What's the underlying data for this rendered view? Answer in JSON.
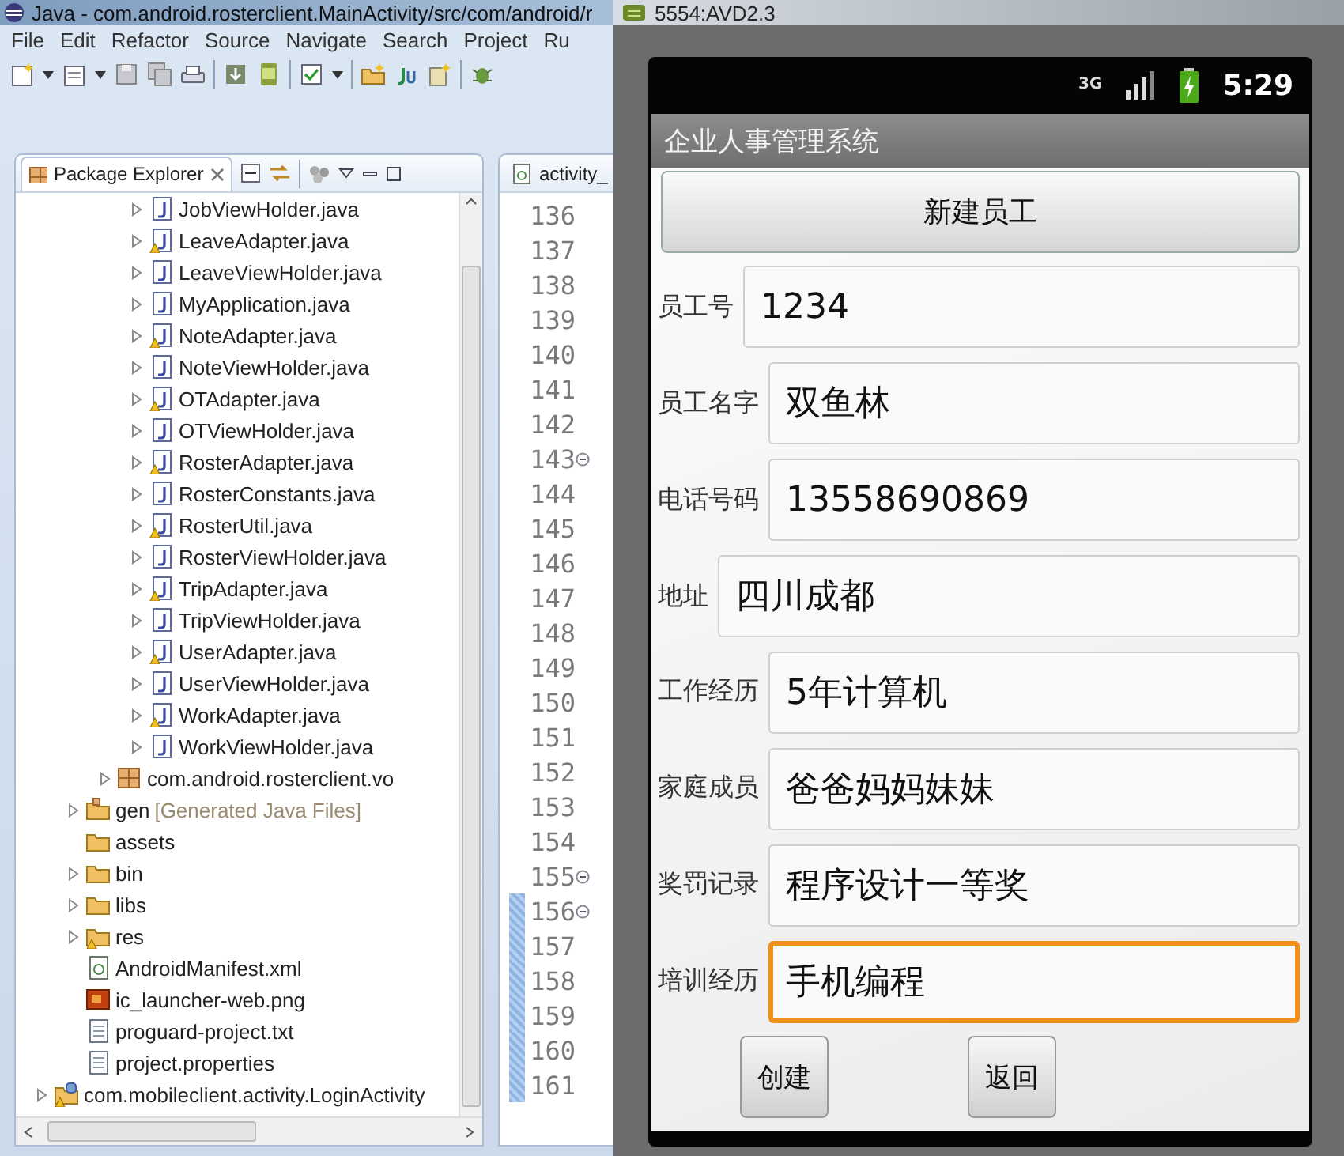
{
  "eclipse": {
    "title": "Java - com.android.rosterclient.MainActivity/src/com/android/r",
    "menu": [
      "File",
      "Edit",
      "Refactor",
      "Source",
      "Navigate",
      "Search",
      "Project",
      "Ru"
    ],
    "view_tab": {
      "label": "Package Explorer",
      "selected": true
    },
    "editor_tab": {
      "label": "activity_",
      "selected": false
    },
    "tree": [
      {
        "children": [
          {
            "children": [
              {
                "children": [
                  {
                    "label": "JobViewHolder.java",
                    "kind": "java-file",
                    "expandable": true,
                    "warning": false
                  },
                  {
                    "label": "LeaveAdapter.java",
                    "kind": "java-file",
                    "expandable": true,
                    "warning": true
                  },
                  {
                    "label": "LeaveViewHolder.java",
                    "kind": "java-file",
                    "expandable": true,
                    "warning": false
                  },
                  {
                    "label": "MyApplication.java",
                    "kind": "java-file",
                    "expandable": true,
                    "warning": false
                  },
                  {
                    "label": "NoteAdapter.java",
                    "kind": "java-file",
                    "expandable": true,
                    "warning": true
                  },
                  {
                    "label": "NoteViewHolder.java",
                    "kind": "java-file",
                    "expandable": true,
                    "warning": false
                  },
                  {
                    "label": "OTAdapter.java",
                    "kind": "java-file",
                    "expandable": true,
                    "warning": true
                  },
                  {
                    "label": "OTViewHolder.java",
                    "kind": "java-file",
                    "expandable": true,
                    "warning": false
                  },
                  {
                    "label": "RosterAdapter.java",
                    "kind": "java-file",
                    "expandable": true,
                    "warning": true
                  },
                  {
                    "label": "RosterConstants.java",
                    "kind": "java-file",
                    "expandable": true,
                    "warning": false
                  },
                  {
                    "label": "RosterUtil.java",
                    "kind": "java-file",
                    "expandable": true,
                    "warning": true
                  },
                  {
                    "label": "RosterViewHolder.java",
                    "kind": "java-file",
                    "expandable": true,
                    "warning": false
                  },
                  {
                    "label": "TripAdapter.java",
                    "kind": "java-file",
                    "expandable": true,
                    "warning": true
                  },
                  {
                    "label": "TripViewHolder.java",
                    "kind": "java-file",
                    "expandable": true,
                    "warning": false
                  },
                  {
                    "label": "UserAdapter.java",
                    "kind": "java-file",
                    "expandable": true,
                    "warning": true
                  },
                  {
                    "label": "UserViewHolder.java",
                    "kind": "java-file",
                    "expandable": true,
                    "warning": false
                  },
                  {
                    "label": "WorkAdapter.java",
                    "kind": "java-file",
                    "expandable": true,
                    "warning": true
                  },
                  {
                    "label": "WorkViewHolder.java",
                    "kind": "java-file",
                    "expandable": true,
                    "warning": false
                  }
                ]
              },
              {
                "label": "com.android.rosterclient.vo",
                "kind": "package",
                "expandable": true,
                "warning": false
              }
            ]
          },
          {
            "label": "gen",
            "note": "[Generated Java Files]",
            "kind": "source-folder",
            "expandable": true,
            "warning": false
          },
          {
            "label": "assets",
            "kind": "folder",
            "expandable": false,
            "warning": false
          },
          {
            "label": "bin",
            "kind": "folder",
            "expandable": true,
            "warning": false
          },
          {
            "label": "libs",
            "kind": "folder",
            "expandable": true,
            "warning": false
          },
          {
            "label": "res",
            "kind": "folder",
            "expandable": true,
            "warning": true
          },
          {
            "label": "AndroidManifest.xml",
            "kind": "xml-file",
            "expandable": false,
            "warning": false
          },
          {
            "label": "ic_launcher-web.png",
            "kind": "image-file",
            "expandable": false,
            "warning": false
          },
          {
            "label": "proguard-project.txt",
            "kind": "text-file",
            "expandable": false,
            "warning": false
          },
          {
            "label": "project.properties",
            "kind": "text-file",
            "expandable": false,
            "warning": false
          }
        ]
      },
      {
        "label": "com.mobileclient.activity.LoginActivity",
        "kind": "project",
        "expandable": true,
        "warning": true
      }
    ],
    "line_numbers": [
      {
        "number": "136",
        "fold": false,
        "marked": false
      },
      {
        "number": "137",
        "fold": false,
        "marked": false
      },
      {
        "number": "138",
        "fold": false,
        "marked": false
      },
      {
        "number": "139",
        "fold": false,
        "marked": false
      },
      {
        "number": "140",
        "fold": false,
        "marked": false
      },
      {
        "number": "141",
        "fold": false,
        "marked": false
      },
      {
        "number": "142",
        "fold": false,
        "marked": false
      },
      {
        "number": "143",
        "fold": true,
        "marked": false
      },
      {
        "number": "144",
        "fold": false,
        "marked": false
      },
      {
        "number": "145",
        "fold": false,
        "marked": false
      },
      {
        "number": "146",
        "fold": false,
        "marked": false
      },
      {
        "number": "147",
        "fold": false,
        "marked": false
      },
      {
        "number": "148",
        "fold": false,
        "marked": false
      },
      {
        "number": "149",
        "fold": false,
        "marked": false
      },
      {
        "number": "150",
        "fold": false,
        "marked": false
      },
      {
        "number": "151",
        "fold": false,
        "marked": false
      },
      {
        "number": "152",
        "fold": false,
        "marked": false
      },
      {
        "number": "153",
        "fold": false,
        "marked": false
      },
      {
        "number": "154",
        "fold": false,
        "marked": false
      },
      {
        "number": "155",
        "fold": true,
        "marked": false
      },
      {
        "number": "156",
        "fold": true,
        "marked": true
      },
      {
        "number": "157",
        "fold": false,
        "marked": true
      },
      {
        "number": "158",
        "fold": false,
        "marked": true
      },
      {
        "number": "159",
        "fold": false,
        "marked": true
      },
      {
        "number": "160",
        "fold": false,
        "marked": true
      },
      {
        "number": "161",
        "fold": false,
        "marked": true
      }
    ]
  },
  "emulator": {
    "title": "5554:AVD2.3",
    "status_bar": {
      "network": "3G",
      "time": "5:29"
    },
    "app_title": "企业人事管理系统",
    "top_button": "新建员工",
    "fields": [
      {
        "label": "员工号",
        "value": "1234",
        "focused": false
      },
      {
        "label": "员工名字",
        "value": "双鱼林",
        "focused": false
      },
      {
        "label": "电话号码",
        "value": "13558690869",
        "focused": false
      },
      {
        "label": "地址",
        "value": "四川成都",
        "focused": false
      },
      {
        "label": "工作经历",
        "value": "5年计算机",
        "focused": false
      },
      {
        "label": "家庭成员",
        "value": "爸爸妈妈妹妹",
        "focused": false
      },
      {
        "label": "奖罚记录",
        "value": "程序设计一等奖",
        "focused": false
      },
      {
        "label": "培训经历",
        "value": "手机编程",
        "focused": true
      }
    ],
    "buttons": [
      "创建",
      "返回"
    ]
  }
}
